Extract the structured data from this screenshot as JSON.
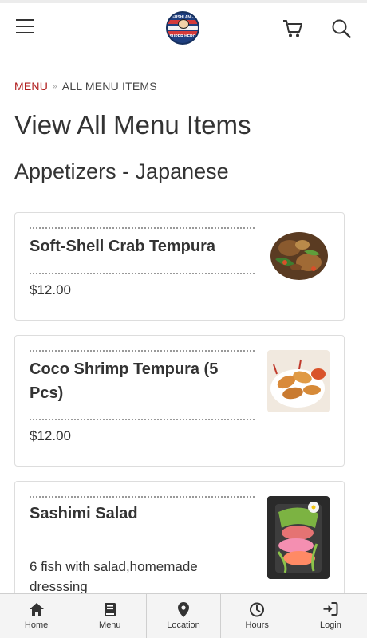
{
  "header": {
    "logo_top_text": "SUSHI AND THAI",
    "logo_bottom_text": "SUPER HERO"
  },
  "breadcrumb": {
    "menu_label": "MENU",
    "separator": "»",
    "current_label": "ALL MENU ITEMS"
  },
  "page_title": "View All Menu Items",
  "category_title": "Appetizers - Japanese",
  "items": [
    {
      "name": "Soft-Shell Crab Tempura",
      "price": "$12.00",
      "description": ""
    },
    {
      "name": "Coco Shrimp Tempura (5 Pcs)",
      "price": "$12.00",
      "description": ""
    },
    {
      "name": "Sashimi Salad",
      "price": "",
      "description": "6 fish with salad,homemade dresssing"
    }
  ],
  "tabbar": {
    "tabs": [
      {
        "label": "Home",
        "icon": "home-icon"
      },
      {
        "label": "Menu",
        "icon": "menu-book-icon"
      },
      {
        "label": "Location",
        "icon": "location-pin-icon"
      },
      {
        "label": "Hours",
        "icon": "clock-icon"
      },
      {
        "label": "Login",
        "icon": "login-icon"
      }
    ]
  },
  "colors": {
    "breadcrumb_accent": "#b01c1c",
    "logo_blue": "#1f3f80"
  }
}
